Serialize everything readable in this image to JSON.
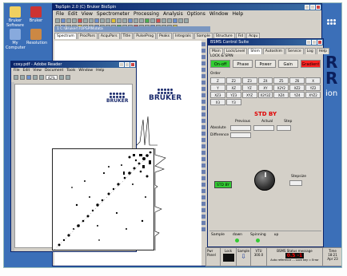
{
  "desktop": {
    "icons": [
      {
        "label": "Bruker Software",
        "color": "#f0d060"
      },
      {
        "label": "Bruker",
        "color": "#cc3333"
      },
      {
        "label": "My Computer",
        "color": "#88aadd"
      },
      {
        "label": "Resolution",
        "color": "#cc8844"
      }
    ]
  },
  "topspin": {
    "title": "TopSpin 2.0 (C) Bruker BioSpin",
    "menu": [
      "File",
      "Edit",
      "View",
      "Spectrometer",
      "Processing",
      "Analysis",
      "Options",
      "Window",
      "Help"
    ],
    "data_title": "1 C:\\Bruker\\TOPSPIN\\data",
    "tabs": [
      "Spectrum",
      "ProcPars",
      "AcquPars",
      "Title",
      "PulseProg",
      "Peaks",
      "Integrals",
      "Sample",
      "Structure",
      "Fid",
      "Acqu"
    ],
    "logo_word": "BRUKER"
  },
  "acrobat": {
    "title": "cosy.pdf - Adobe Reader",
    "menu": [
      "File",
      "Edit",
      "View",
      "Document",
      "Tools",
      "Window",
      "Help"
    ],
    "zoom": "42%"
  },
  "bsms": {
    "title": "BSMS Control Suite",
    "tabs": [
      "Main",
      "Lock/Level",
      "Shim",
      "Autoshim",
      "Service",
      "Log",
      "Help"
    ],
    "lock_label": "LOCK & SPIN",
    "lock_buttons": [
      {
        "label": "On-off",
        "color": "green"
      },
      {
        "label": "Phase",
        "color": "gray"
      },
      {
        "label": "Power",
        "color": "gray"
      },
      {
        "label": "Gain",
        "color": "gray"
      },
      {
        "label": "Gradient",
        "color": "red"
      }
    ],
    "order_label": "Order",
    "shims": [
      "Z",
      "Z2",
      "Z3",
      "Z4",
      "Z5",
      "Z6",
      "X",
      "Y",
      "XZ",
      "YZ",
      "XY",
      "X2Y2",
      "XZ2",
      "YZ2",
      "XZ3",
      "YZ3",
      "XYZ",
      "X2Y2Z",
      "XZ4",
      "YZ4",
      "XYZ2",
      "X3",
      "Y3",
      "",
      "",
      "",
      "",
      ""
    ],
    "status": "STD BY",
    "col_previous": "Previous",
    "col_actual": "Actual",
    "col_step": "Step",
    "row_absolute": "Absolute",
    "row_difference": "Difference",
    "stepsize_label": "Stepsize",
    "stdby_button": "STD BY",
    "footer": {
      "sample": "Sample",
      "down": "down",
      "spinning": "Spinning",
      "up": "up"
    }
  },
  "statusbar": {
    "cells": [
      "Pwr Panel",
      "Lock",
      "Sample",
      "VTU",
      "BSMS Status message",
      "Time"
    ],
    "temperature": "300.0",
    "lock_value": "0.5 -1",
    "message": "Auto reference ... Lock key = Error",
    "time": "18:21",
    "date": "Apr 23"
  }
}
